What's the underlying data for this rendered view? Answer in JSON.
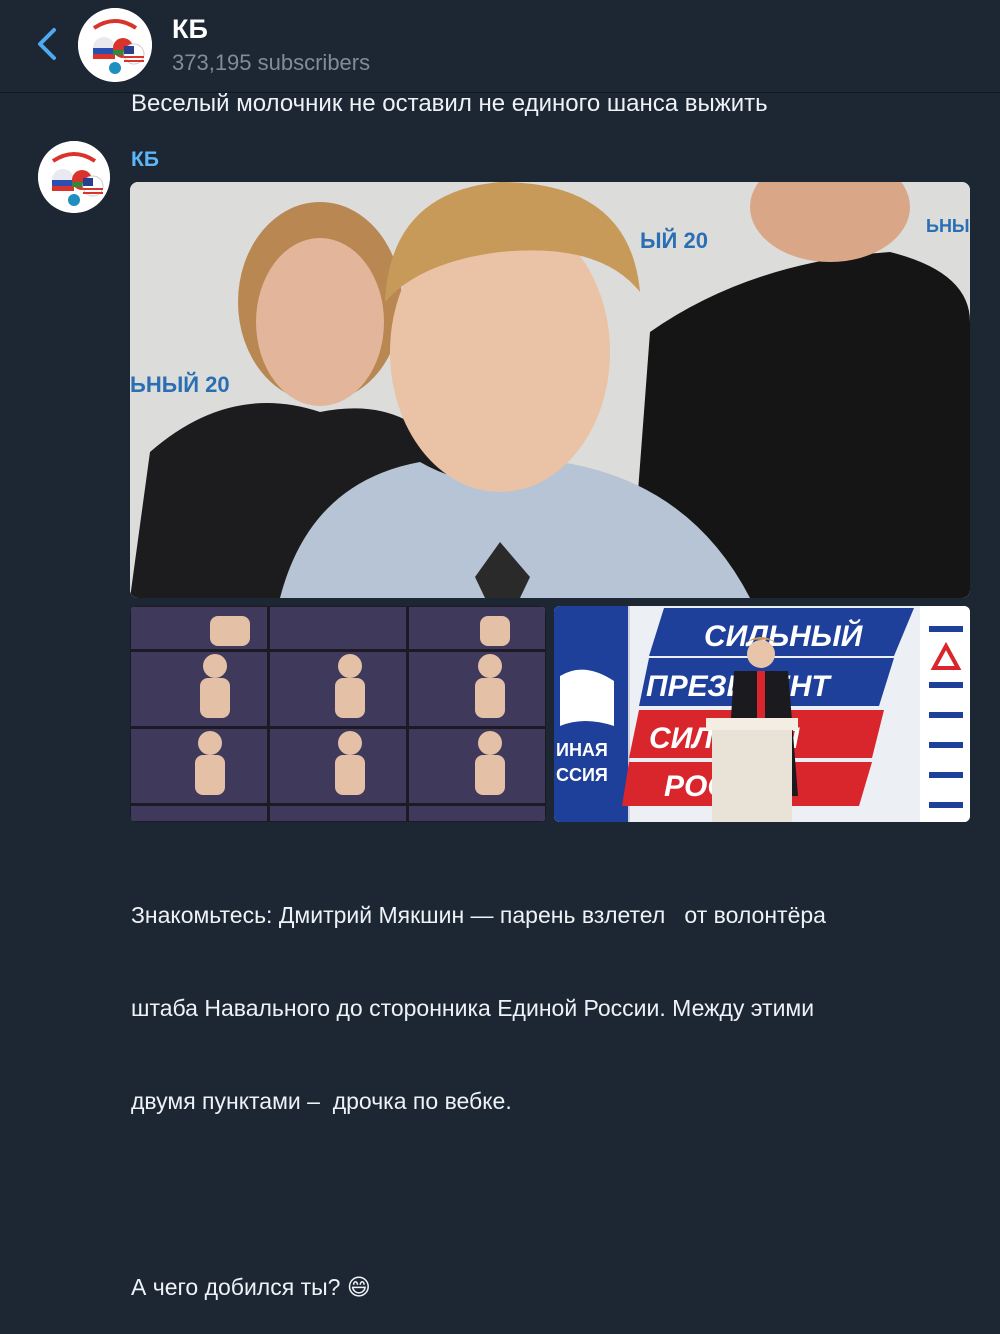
{
  "header": {
    "title": "КБ",
    "subscribers": "373,195 subscribers"
  },
  "previous_message": {
    "text": "Веселый молочник не оставил не единого шанса выжить"
  },
  "post": {
    "author": "КБ",
    "text_lines": [
      "Знакомьтесь: Дмитрий Мякшин — парень взлетел   от волонтёра",
      "штаба Навального до сторонника Единой России. Между этими",
      "двумя пунктами –  дрочка по вебке.",
      "",
      "А чего добился ты? 😄"
    ],
    "photos": {
      "main_backdrop_left": "ЬНЫЙ 20",
      "main_backdrop_right": "ЫЙ 20",
      "main_backdrop_corner": "ЬНЫ",
      "stage_line1": "СИЛЬНЫЙ",
      "stage_line2": "ПРЕЗИДЕНТ",
      "stage_line3": "СИЛЬНАЯ",
      "stage_line4": "РОССИЯ",
      "stage_party1": "ИНАЯ",
      "stage_party2": "ССИЯ"
    }
  },
  "colors": {
    "background": "#1d2733",
    "accent": "#5eb5f7",
    "secondary_text": "#7f8c99"
  }
}
